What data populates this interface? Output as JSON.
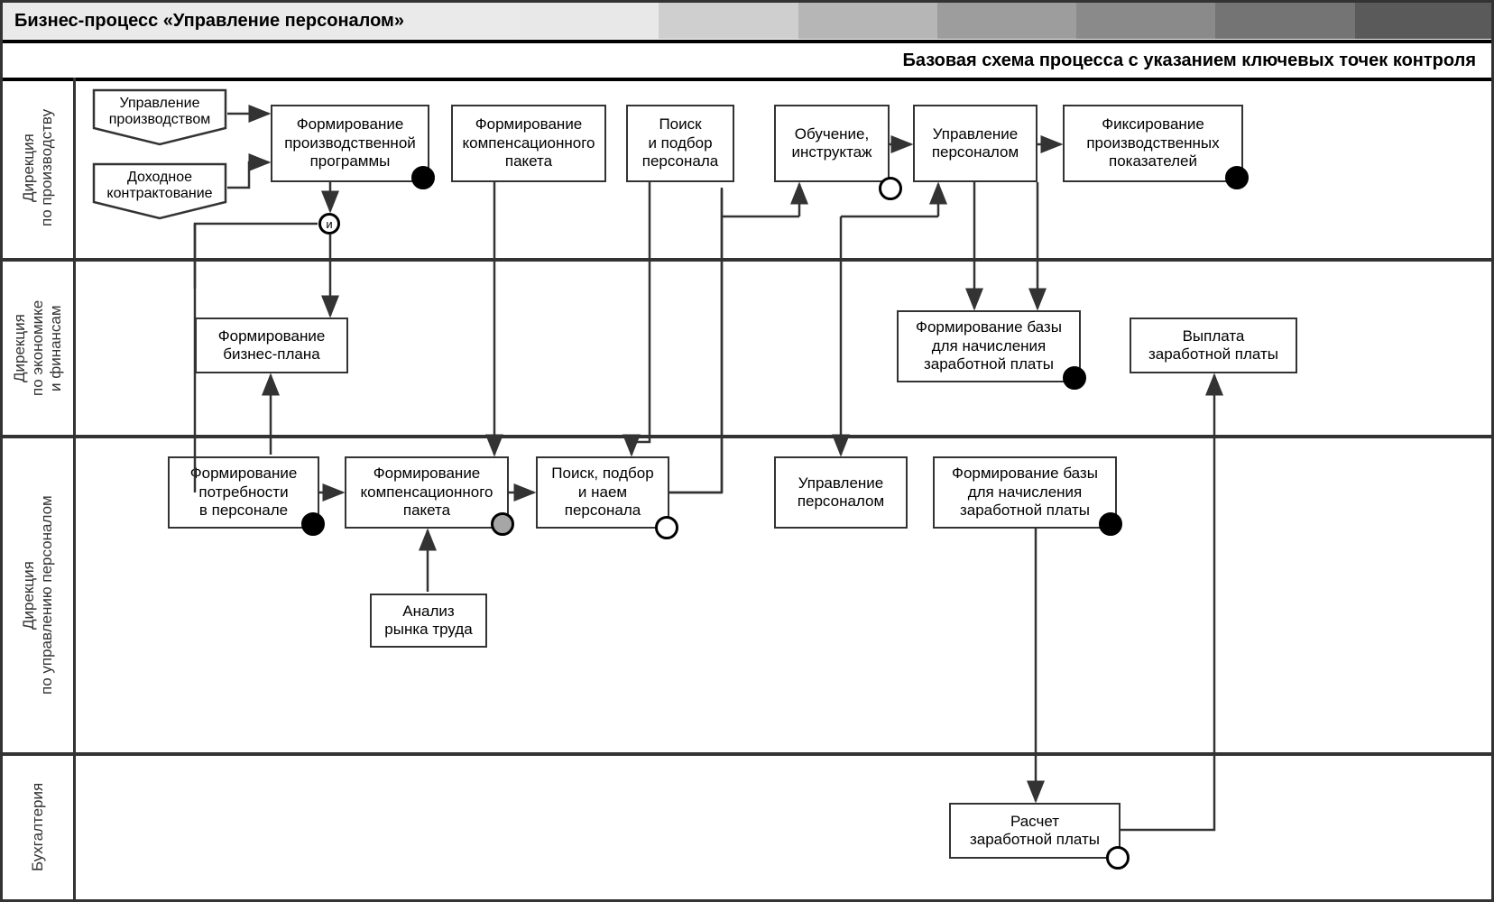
{
  "header_title": "Бизнес-процесс «Управление персоналом»",
  "subheader": "Базовая схема процесса с указанием ключевых точек контроля",
  "lanes": [
    "Дирекция\nпо производству",
    "Дирекция\nпо экономике\nи финансам",
    "Дирекция\nпо управлению персоналом",
    "Бухгалтерия"
  ],
  "gateway": "и",
  "docs": {
    "prod": "Управление\nпроизводством",
    "contract": "Доходное\nконтрактование"
  },
  "nodes": {
    "form_prog": "Формирование\nпроизводственной\nпрограммы",
    "form_comp_top": "Формирование\nкомпенсационного\nпакета",
    "search": "Поиск\nи подбор\nперсонала",
    "training": "Обучение,\nинструктаж",
    "mgmt_top": "Управление\nперсоналом",
    "fix_perf": "Фиксирование\nпроизводственных\nпоказателей",
    "biz_plan": "Формирование\nбизнес-плана",
    "base_fin": "Формирование базы\nдля начисления\nзаработной платы",
    "payout": "Выплата\nзаработной платы",
    "need": "Формирование\nпотребности\nв персонале",
    "form_comp_hr": "Формирование\nкомпенсационного\nпакета",
    "hire": "Поиск, подбор\nи наем\nперсонала",
    "mgmt_hr": "Управление\nперсоналом",
    "base_hr": "Формирование базы\nдля начисления\nзаработной платы",
    "analysis": "Анализ\nрынка труда",
    "payroll": "Расчет\nзаработной платы"
  },
  "colors": {
    "grad": [
      "#e8e8e8",
      "#cfcfcf",
      "#b6b6b6",
      "#9d9d9d",
      "#8a8a8a",
      "#747474",
      "#5a5a5a"
    ]
  }
}
